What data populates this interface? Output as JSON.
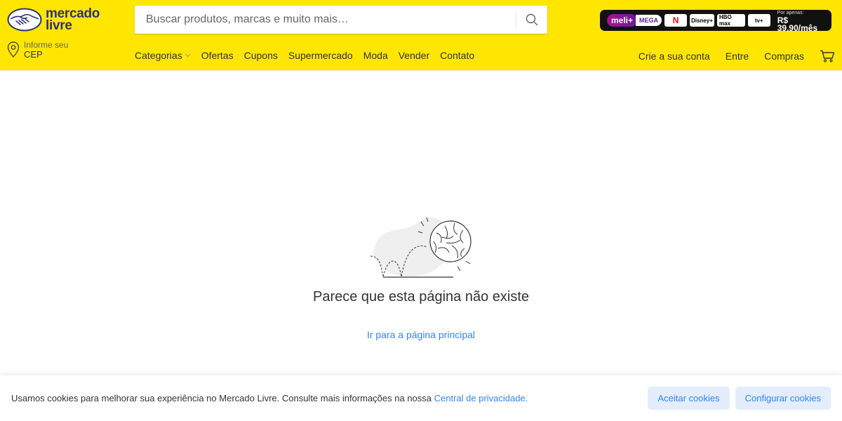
{
  "header": {
    "logo_text_line1": "mercado",
    "logo_text_line2": "livre",
    "search_placeholder": "Buscar produtos, marcas e muito mais…",
    "promo": {
      "brand": "meli+",
      "tier": "MEGA",
      "services": [
        "N",
        "Disney+",
        "HBO max",
        "tv+"
      ],
      "price_prefix": "Por apenas:",
      "price": "R$ 39,90/mês"
    },
    "location_line1": "Informe seu",
    "location_line2": "CEP",
    "nav": [
      "Categorias",
      "Ofertas",
      "Cupons",
      "Supermercado",
      "Moda",
      "Vender",
      "Contato"
    ],
    "account_links": [
      "Crie a sua conta",
      "Entre",
      "Compras"
    ]
  },
  "main": {
    "title": "Parece que esta página não existe",
    "home_link": "Ir para a página principal"
  },
  "cookie_banner": {
    "text": "Usamos cookies para melhorar sua experiência no Mercado Livre. Consulte mais informações na nossa ",
    "privacy_link": "Central de privacidade.",
    "accept_button": "Aceitar cookies",
    "configure_button": "Configurar cookies"
  },
  "colors": {
    "brand_yellow": "#ffe600",
    "link_blue": "#3483fa",
    "button_bg": "#e3edfb"
  }
}
